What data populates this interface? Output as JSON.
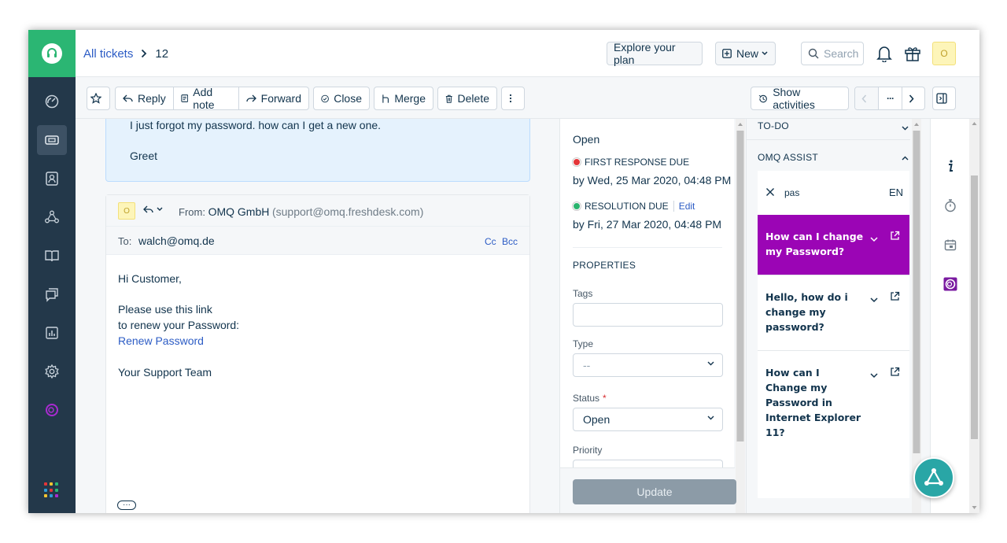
{
  "header": {
    "breadcrumb_link": "All tickets",
    "ticket_number": "12",
    "explore_label": "Explore your plan",
    "new_label": "New",
    "search_placeholder": "Search",
    "avatar_letter": "O"
  },
  "toolbar": {
    "reply_label": "Reply",
    "add_note_label": "Add note",
    "forward_label": "Forward",
    "close_label": "Close",
    "merge_label": "Merge",
    "delete_label": "Delete",
    "show_activities_label": "Show activities",
    "more_label": "···"
  },
  "conversation": {
    "customer_message_line1": "I just forgot my password. how can I get a new one.",
    "customer_message_line2": "Greet",
    "reply": {
      "avatar_letter": "O",
      "from_label": "From:",
      "from_name": "OMQ GmbH",
      "from_email": "(support@omq.freshdesk.com)",
      "to_label": "To:",
      "to_value": "walch@omq.de",
      "cc_label": "Cc",
      "bcc_label": "Bcc",
      "greeting": "Hi Customer,",
      "line1": "Please use this link",
      "line2": "to renew your Password:",
      "link_text": "Renew Password",
      "signature": "Your Support Team"
    }
  },
  "properties": {
    "status_text": "Open",
    "first_response_label": "FIRST RESPONSE DUE",
    "first_response_date": "by Wed, 25 Mar 2020, 04:48 PM",
    "resolution_label": "RESOLUTION DUE",
    "resolution_edit": "Edit",
    "resolution_date": "by Fri, 27 Mar 2020, 04:48 PM",
    "section_title": "PROPERTIES",
    "tags_label": "Tags",
    "type_label": "Type",
    "type_value": "--",
    "status_label": "Status",
    "required_mark": "*",
    "status_value": "Open",
    "priority_label": "Priority",
    "update_label": "Update"
  },
  "assist": {
    "todo_title": "TO-DO",
    "omq_title": "OMQ ASSIST",
    "search_value": "pas",
    "language": "EN",
    "results": [
      {
        "text": "How can I change my Password?"
      },
      {
        "text": "Hello, how do i change my password?"
      },
      {
        "text": "How can I Change my Password in Internet Explorer 11?"
      }
    ]
  },
  "colors": {
    "sidebar": "#23384a",
    "brand_green": "#2bb673",
    "omq_purple": "#9b05b5",
    "link_blue": "#2c5cc5",
    "fab_teal": "#29a6a6",
    "first_response_dot": "#e43538",
    "resolution_dot": "#2ab46e"
  }
}
